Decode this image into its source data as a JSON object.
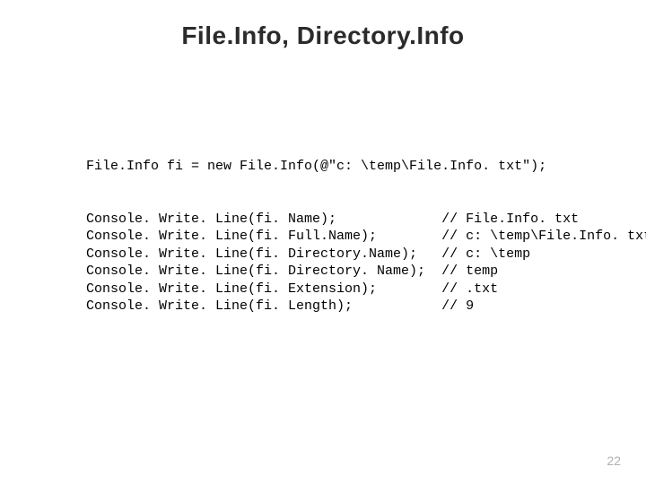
{
  "title": "File.Info, Directory.Info",
  "code": {
    "decl": "File.Info fi = new File.Info(@\"c: \\temp\\File.Info. txt\");",
    "lines": [
      {
        "stmt": "Console. Write. Line(fi. Name);",
        "comment": "// File.Info. txt"
      },
      {
        "stmt": "Console. Write. Line(fi. Full.Name);",
        "comment": "// c: \\temp\\File.Info. txt"
      },
      {
        "stmt": "Console. Write. Line(fi. Directory.Name);",
        "comment": "// c: \\temp"
      },
      {
        "stmt": "Console. Write. Line(fi. Directory. Name);",
        "comment": "// temp"
      },
      {
        "stmt": "Console. Write. Line(fi. Extension);",
        "comment": "// .txt"
      },
      {
        "stmt": "Console. Write. Line(fi. Length);",
        "comment": "// 9"
      }
    ]
  },
  "page_number": "22"
}
